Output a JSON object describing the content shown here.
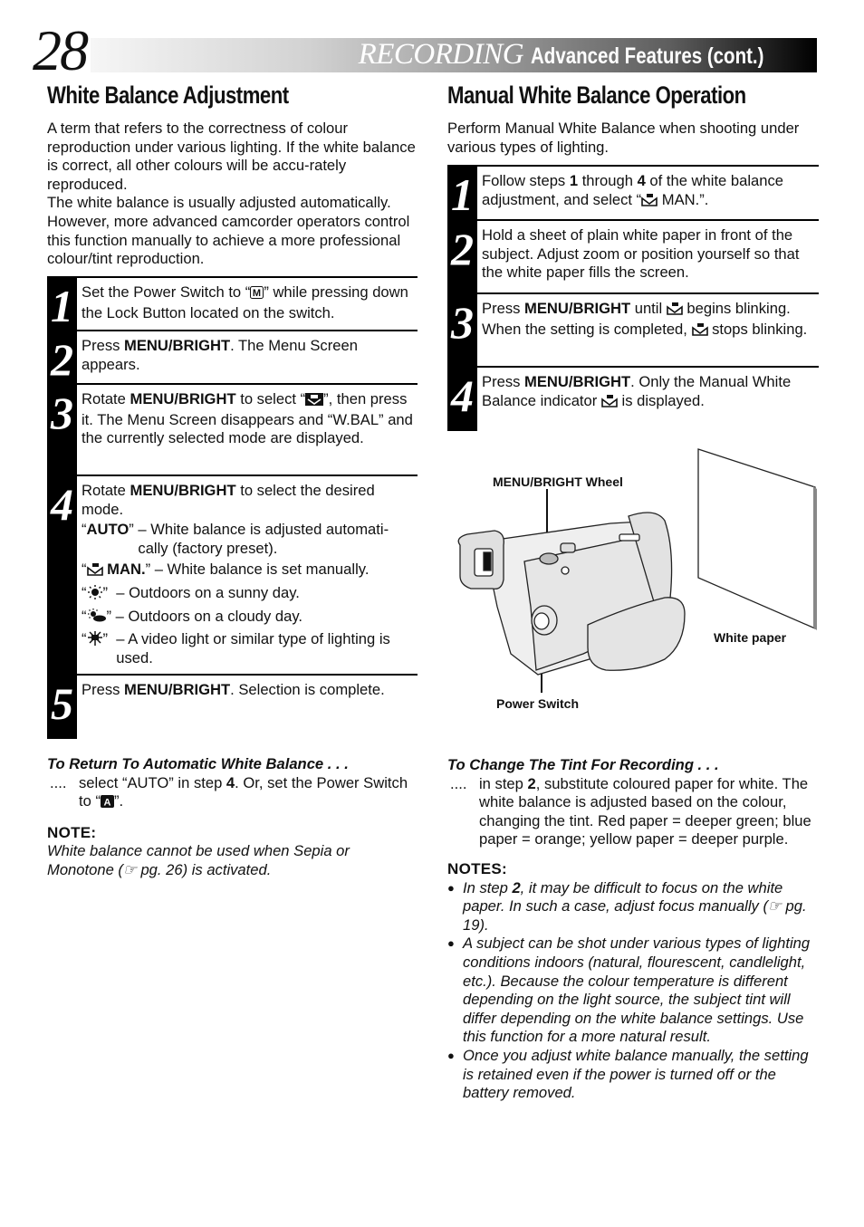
{
  "header": {
    "page_number": "28",
    "section": "RECORDING",
    "subtitle": "Advanced Features (cont.)"
  },
  "left": {
    "title": "White Balance Adjustment",
    "intro": [
      "A term that refers to the correctness of colour reproduction under various lighting. If the white balance is correct, all other colours will be accu-rately reproduced.",
      "The white balance is usually adjusted automatically. However, more advanced camcorder operators control this function manually to achieve a more professional colour/tint reproduction."
    ],
    "steps": [
      {
        "num": "1",
        "pre": "Set the Power Switch to “",
        "icon": "M",
        "post": "” while pressing down the Lock Button located on the switch."
      },
      {
        "num": "2",
        "pre": "Press ",
        "bold": "MENU/BRIGHT",
        "post": ". The Menu Screen appears."
      },
      {
        "num": "3",
        "pre": "Rotate ",
        "bold": "MENU/BRIGHT",
        "mid": " to select “",
        "post": "”, then press it. The Menu Screen disappears and “W.BAL” and the currently selected mode are displayed."
      },
      {
        "num": "4",
        "pre": "Rotate ",
        "bold": "MENU/BRIGHT",
        "post": " to select the desired mode.",
        "modes": [
          {
            "key_bold": "AUTO",
            "desc": "– White balance is adjusted automati-cally (factory preset)."
          },
          {
            "key_bold": "MAN.",
            "icon": "manual-wb",
            "desc": "– White balance is set manually."
          },
          {
            "icon": "sunny",
            "desc": "–  Outdoors on a sunny day."
          },
          {
            "icon": "cloudy",
            "desc": "– Outdoors on a cloudy day."
          },
          {
            "icon": "video-light",
            "desc": "–  A video light or similar type of lighting is used."
          }
        ]
      },
      {
        "num": "5",
        "pre": "Press ",
        "bold": "MENU/BRIGHT",
        "post": ". Selection is complete."
      }
    ],
    "return_heading": "To Return To Automatic White Balance . . .",
    "return_dots": "....",
    "return_pre": "select “AUTO” in step ",
    "return_step": "4",
    "return_mid": ". Or, set the Power Switch to “",
    "return_icon": "A",
    "return_post": "”.",
    "note_heading": "NOTE:",
    "note_text_pre": "White balance cannot be used when Sepia or Monotone (",
    "note_text_ref": "pg. 26) is activated."
  },
  "right": {
    "title": "Manual White Balance Operation",
    "intro": "Perform Manual White Balance when shooting under various types of lighting.",
    "steps": [
      {
        "num": "1",
        "pre": "Follow steps ",
        "b1": "1",
        "mid1": " through ",
        "b2": "4",
        "mid2": " of the white balance adjustment, and select “",
        "post": " MAN.”."
      },
      {
        "num": "2",
        "text": "Hold a sheet of plain white paper in front of the subject. Adjust zoom or position yourself so that the white paper fills the screen."
      },
      {
        "num": "3",
        "pre": "Press ",
        "bold": "MENU/BRIGHT",
        "mid": " until ",
        "mid2": " begins blinking. When the setting is completed, ",
        "post": " stops blinking."
      },
      {
        "num": "4",
        "pre": "Press ",
        "bold": "MENU/BRIGHT",
        "mid": ". Only the Manual White Balance indicator ",
        "post": " is displayed."
      }
    ],
    "figure": {
      "label_wheel": "MENU/BRIGHT Wheel",
      "label_paper": "White paper",
      "label_power": "Power Switch"
    },
    "tint_heading": "To Change The Tint For Recording . . .",
    "tint_dots": "....",
    "tint_pre": "in step ",
    "tint_step": "2",
    "tint_post": ", substitute coloured paper for white. The white balance is adjusted based on the colour, changing the tint. Red paper = deeper green; blue paper = orange; yellow paper = deeper purple.",
    "notes_heading": "NOTES:",
    "notes": [
      {
        "pre": "In step ",
        "bold": "2",
        "post": ", it may be difficult to focus on the white paper. In such a case, adjust focus manually (",
        "ref": "pg. 19)."
      },
      {
        "text": "A subject can be shot under various types of lighting conditions indoors (natural, flourescent, candlelight, etc.). Because the colour temperature is different depending on the light source, the subject tint will differ depending on the white balance settings. Use this function for a more natural result."
      },
      {
        "text": "Once you adjust white balance manually, the setting is retained even if the power is turned off or the battery removed."
      }
    ]
  }
}
